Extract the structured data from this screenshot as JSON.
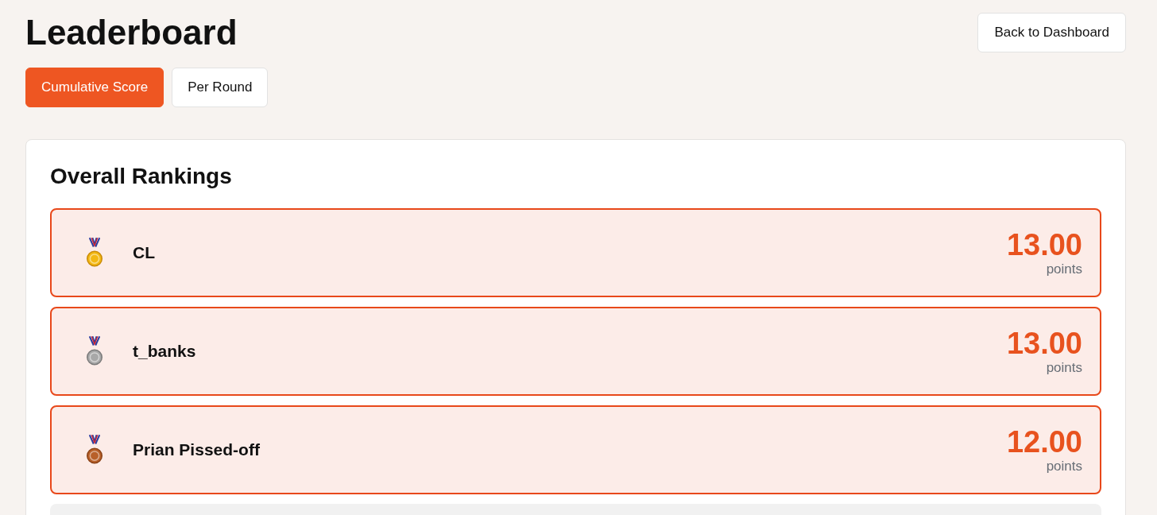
{
  "title": "Leaderboard",
  "back_button": "Back to Dashboard",
  "tabs": [
    {
      "label": "Cumulative Score",
      "selected": true
    },
    {
      "label": "Per Round",
      "selected": false
    }
  ],
  "rankings": {
    "title": "Overall Rankings",
    "rows": [
      {
        "kind": "gold",
        "name": "CL",
        "score": "13.00",
        "unit": "points",
        "highlighted": true
      },
      {
        "kind": "silver",
        "name": "t_banks",
        "score": "13.00",
        "unit": "points",
        "highlighted": true
      },
      {
        "kind": "bronze",
        "name": "Prian Pissed-off",
        "score": "12.00",
        "unit": "points",
        "highlighted": true
      },
      {
        "highlighted": false
      }
    ]
  }
}
